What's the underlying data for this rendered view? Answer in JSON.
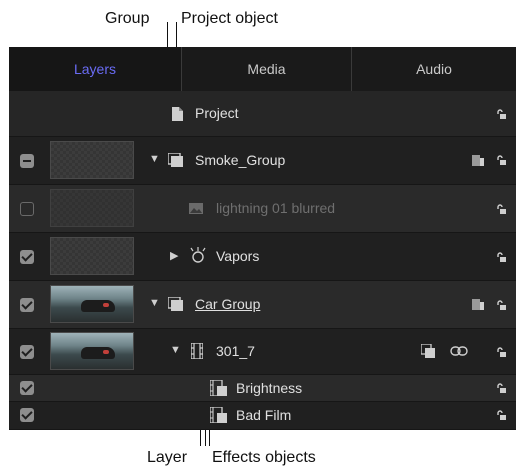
{
  "callouts": {
    "group": "Group",
    "project_object": "Project object",
    "layer": "Layer",
    "effects_objects": "Effects objects"
  },
  "tabs": [
    {
      "label": "Layers",
      "active": true
    },
    {
      "label": "Media",
      "active": false
    },
    {
      "label": "Audio",
      "active": false
    }
  ],
  "rows": [
    {
      "name": "Project",
      "checkbox": "none",
      "kind": "project"
    },
    {
      "name": "Smoke_Group",
      "checkbox": "mixed",
      "kind": "group",
      "expanded": true
    },
    {
      "name": "lightning 01 blurred",
      "checkbox": "off",
      "kind": "image",
      "disabled": true
    },
    {
      "name": "Vapors",
      "checkbox": "on",
      "kind": "emitter",
      "expanded": false
    },
    {
      "name": "Car Group",
      "checkbox": "on",
      "kind": "group",
      "expanded": true
    },
    {
      "name": "301_7",
      "checkbox": "on",
      "kind": "layer",
      "expanded": true
    },
    {
      "name": "Brightness",
      "checkbox": "on",
      "kind": "filter"
    },
    {
      "name": "Bad Film",
      "checkbox": "on",
      "kind": "filter"
    }
  ],
  "colors": {
    "accent": "#6a6cf5",
    "panel": "#232323"
  }
}
